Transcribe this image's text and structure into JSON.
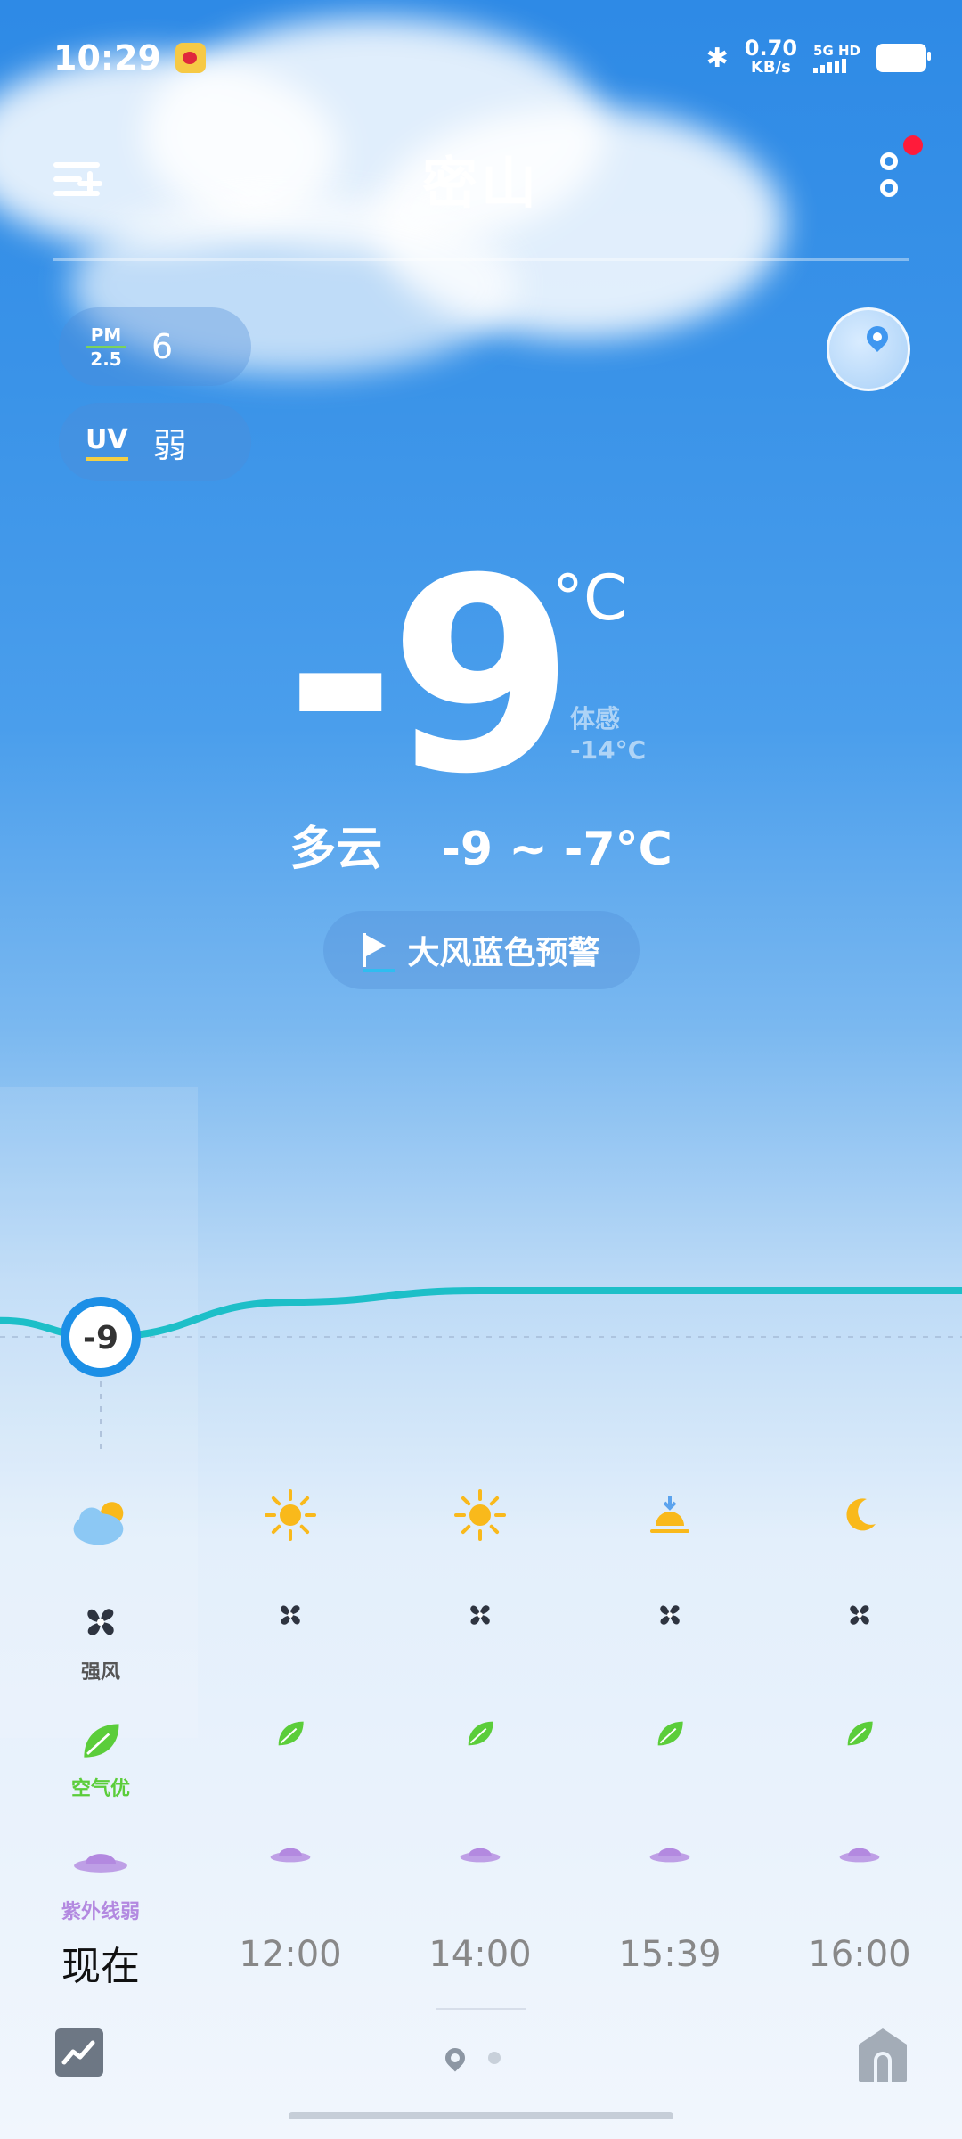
{
  "status_bar": {
    "time": "10:29",
    "net_speed": "0.70",
    "net_unit": "KB/s",
    "net_type": "5G HD"
  },
  "header": {
    "city": "密山"
  },
  "air": {
    "pm_label_top": "PM",
    "pm_label_bottom": "2.5",
    "pm_value": "6",
    "uv_label": "UV",
    "uv_value": "弱"
  },
  "current": {
    "temp": "-9",
    "unit": "°C",
    "feels_label": "体感",
    "feels_value": "-14°C",
    "condition": "多云",
    "range": "-9 ~ -7°C",
    "alert": "大风蓝色预警"
  },
  "hourly": {
    "temps": [
      -9,
      -7.5,
      -7,
      -7,
      -7
    ],
    "now_temp_label": "-9",
    "times": [
      "现在",
      "12:00",
      "14:00",
      "15:39",
      "16:00"
    ],
    "weather_icons": [
      "partly-cloudy",
      "sunny",
      "sunny",
      "sunset",
      "moon"
    ],
    "wind_label": "强风",
    "air_label": "空气优",
    "uv_label": "紫外线弱"
  },
  "colors": {
    "curve": "#1dbfc8",
    "now_marker": "#1c8fe6",
    "air_green": "#5bcd3a",
    "uv_purple": "#b389e0"
  }
}
